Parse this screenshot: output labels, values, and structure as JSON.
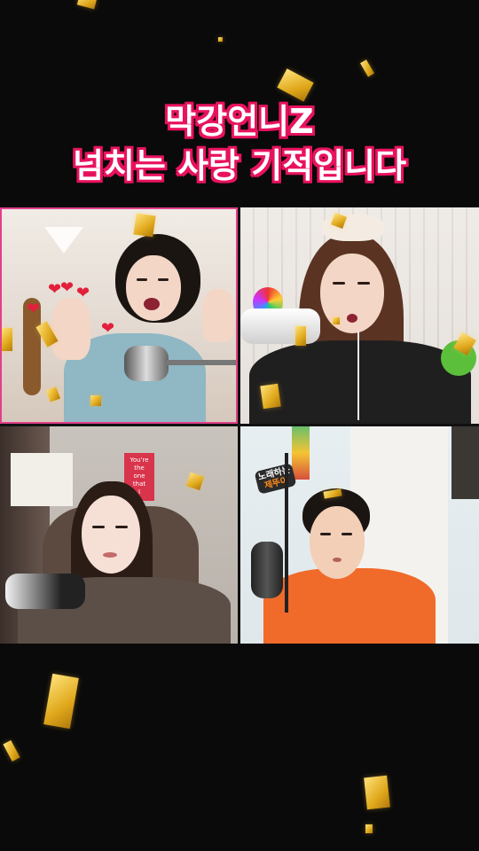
{
  "caption": {
    "line1": "막강언니Z",
    "line2": "넘치는 사랑 기적입니다"
  },
  "panels": {
    "panel3_poster": {
      "lines": [
        "You're",
        "the",
        "one",
        "that",
        "I",
        "w..."
      ]
    },
    "panel4_sign": {
      "top": "노래하는",
      "bottom": "제뚜이"
    }
  },
  "colors": {
    "caption_fill": "#ffffff",
    "caption_outline": "#e8125f",
    "active_border": "#e2408a",
    "confetti": "#f2c233"
  }
}
